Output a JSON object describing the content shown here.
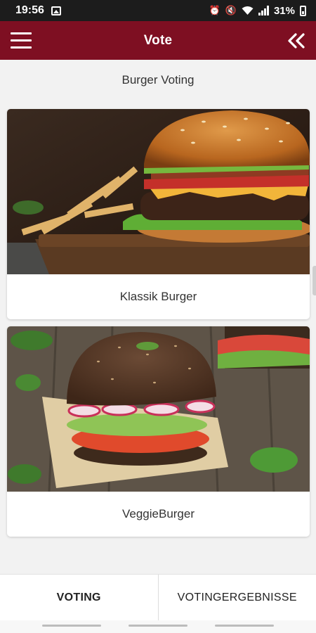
{
  "status_bar": {
    "time": "19:56",
    "battery": "31%",
    "icons": [
      "image-icon",
      "alarm-icon",
      "mute-icon",
      "wifi-icon",
      "signal-icon",
      "battery-icon"
    ]
  },
  "app_bar": {
    "title": "Vote",
    "menu_icon": "hamburger-menu-icon",
    "back_icon": "double-chevron-left-icon",
    "color": "#7e0f22"
  },
  "page": {
    "heading": "Burger Voting"
  },
  "cards": [
    {
      "label": "Klassik Burger",
      "image": "classic-burger-photo"
    },
    {
      "label": "VeggieBurger",
      "image": "veggie-burger-photo"
    }
  ],
  "tabs": [
    {
      "label": "VOTING",
      "active": true
    },
    {
      "label": "VOTINGERGEBNISSE",
      "active": false
    }
  ]
}
